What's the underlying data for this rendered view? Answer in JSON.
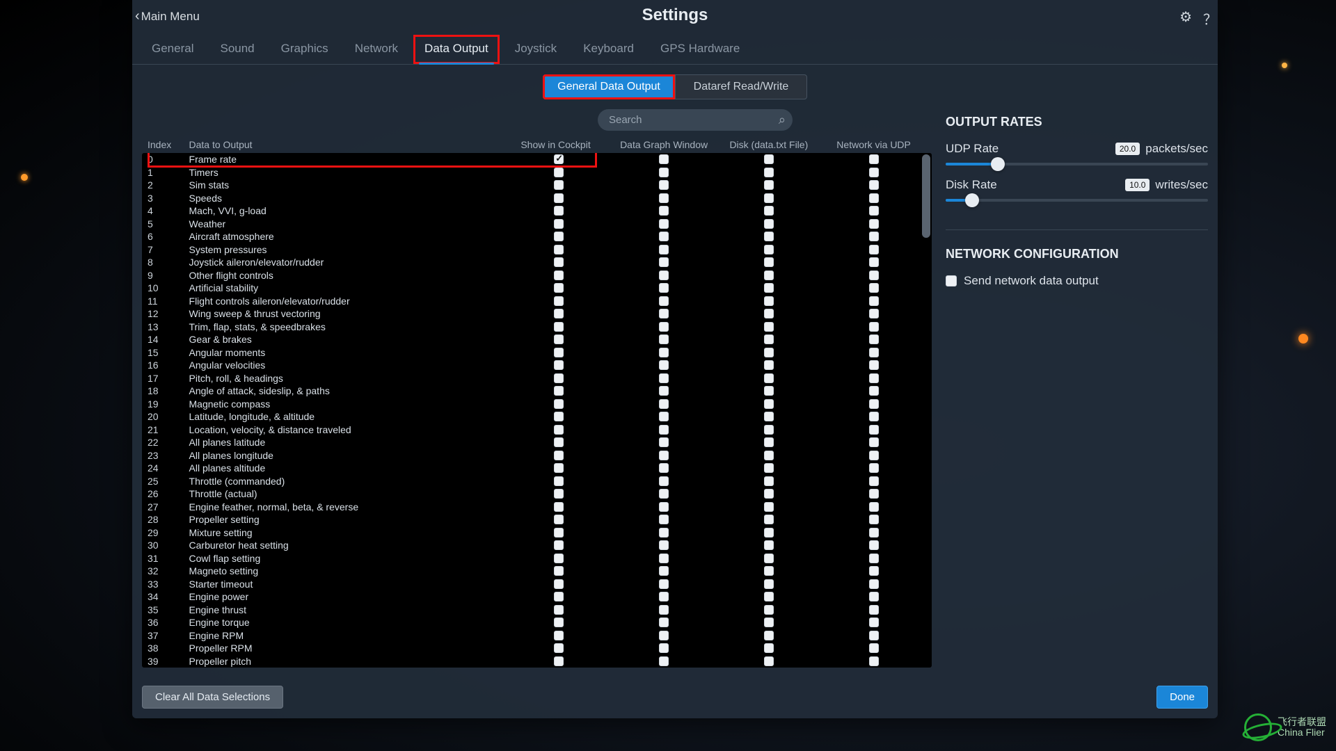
{
  "header": {
    "title": "Settings",
    "back_label": "Main Menu"
  },
  "tabs": [
    "General",
    "Sound",
    "Graphics",
    "Network",
    "Data Output",
    "Joystick",
    "Keyboard",
    "GPS Hardware"
  ],
  "active_tab": "Data Output",
  "subtabs": {
    "general": "General Data Output",
    "dataref": "Dataref Read/Write"
  },
  "search": {
    "placeholder": "Search"
  },
  "columns": {
    "index": "Index",
    "label": "Data to Output",
    "c1": "Show in Cockpit",
    "c2": "Data Graph Window",
    "c3": "Disk (data.txt File)",
    "c4": "Network via UDP"
  },
  "rows": [
    {
      "i": 0,
      "l": "Frame rate",
      "c": true,
      "hl": true
    },
    {
      "i": 1,
      "l": "Timers"
    },
    {
      "i": 2,
      "l": "Sim stats"
    },
    {
      "i": 3,
      "l": "Speeds"
    },
    {
      "i": 4,
      "l": "Mach, VVI, g-load"
    },
    {
      "i": 5,
      "l": "Weather"
    },
    {
      "i": 6,
      "l": "Aircraft atmosphere"
    },
    {
      "i": 7,
      "l": "System pressures"
    },
    {
      "i": 8,
      "l": "Joystick aileron/elevator/rudder"
    },
    {
      "i": 9,
      "l": "Other flight controls"
    },
    {
      "i": 10,
      "l": "Artificial stability"
    },
    {
      "i": 11,
      "l": "Flight controls aileron/elevator/rudder"
    },
    {
      "i": 12,
      "l": "Wing sweep & thrust vectoring"
    },
    {
      "i": 13,
      "l": "Trim, flap, stats, & speedbrakes"
    },
    {
      "i": 14,
      "l": "Gear & brakes"
    },
    {
      "i": 15,
      "l": "Angular moments"
    },
    {
      "i": 16,
      "l": "Angular velocities"
    },
    {
      "i": 17,
      "l": "Pitch, roll, & headings"
    },
    {
      "i": 18,
      "l": "Angle of attack, sideslip, & paths"
    },
    {
      "i": 19,
      "l": "Magnetic compass"
    },
    {
      "i": 20,
      "l": "Latitude, longitude, & altitude"
    },
    {
      "i": 21,
      "l": "Location, velocity, & distance traveled"
    },
    {
      "i": 22,
      "l": "All planes latitude"
    },
    {
      "i": 23,
      "l": "All planes longitude"
    },
    {
      "i": 24,
      "l": "All planes altitude"
    },
    {
      "i": 25,
      "l": "Throttle (commanded)"
    },
    {
      "i": 26,
      "l": "Throttle (actual)"
    },
    {
      "i": 27,
      "l": "Engine feather, normal, beta, & reverse"
    },
    {
      "i": 28,
      "l": "Propeller setting"
    },
    {
      "i": 29,
      "l": "Mixture setting"
    },
    {
      "i": 30,
      "l": "Carburetor heat setting"
    },
    {
      "i": 31,
      "l": "Cowl flap setting"
    },
    {
      "i": 32,
      "l": "Magneto setting"
    },
    {
      "i": 33,
      "l": "Starter timeout"
    },
    {
      "i": 34,
      "l": "Engine power"
    },
    {
      "i": 35,
      "l": "Engine thrust"
    },
    {
      "i": 36,
      "l": "Engine torque"
    },
    {
      "i": 37,
      "l": "Engine RPM"
    },
    {
      "i": 38,
      "l": "Propeller RPM"
    },
    {
      "i": 39,
      "l": "Propeller pitch"
    }
  ],
  "footer": {
    "clear": "Clear All Data Selections",
    "done": "Done"
  },
  "rates": {
    "title": "OUTPUT RATES",
    "udp_label": "UDP Rate",
    "udp_value": "20.0",
    "udp_unit": "packets/sec",
    "udp_pct": 20,
    "disk_label": "Disk Rate",
    "disk_value": "10.0",
    "disk_unit": "writes/sec",
    "disk_pct": 10
  },
  "network": {
    "title": "NETWORK CONFIGURATION",
    "send_label": "Send network data output"
  },
  "watermark": {
    "line1": "飞行者联盟",
    "line2": "China Flier"
  }
}
